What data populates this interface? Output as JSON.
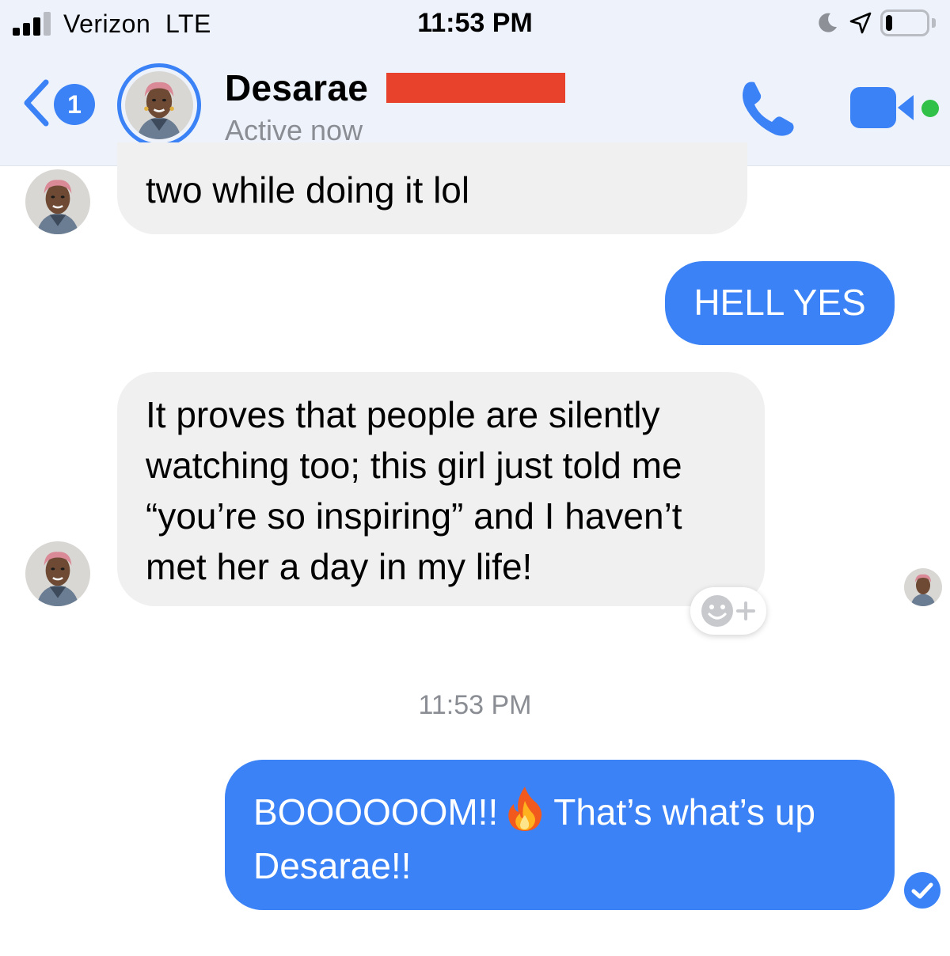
{
  "status_bar": {
    "carrier": "Verizon  LTE",
    "time": "11:53 PM",
    "battery_level": 0.15
  },
  "header": {
    "contact_name": "Desarae",
    "status": "Active now",
    "unread_count": "1",
    "icons": {
      "back": "chevron-left-icon",
      "call": "phone-icon",
      "video": "video-camera-icon"
    }
  },
  "messages": [
    {
      "direction": "incoming",
      "text": "two while doing it lol"
    },
    {
      "direction": "outgoing",
      "text": "HELL YES"
    },
    {
      "direction": "incoming",
      "text": "It proves that people are silently watching too; this girl just told me “you’re so inspiring” and I haven’t met her a day in my life!"
    },
    {
      "direction": "outgoing",
      "text_part1": "BOOOOOOM!!",
      "text_part2": "That’s what’s up Desarae!!"
    }
  ],
  "timestamp": "11:53 PM",
  "colors": {
    "accent": "#3b82f6",
    "incoming_bubble": "#f0f0f0",
    "online": "#31c048",
    "redaction": "#e8412c"
  }
}
